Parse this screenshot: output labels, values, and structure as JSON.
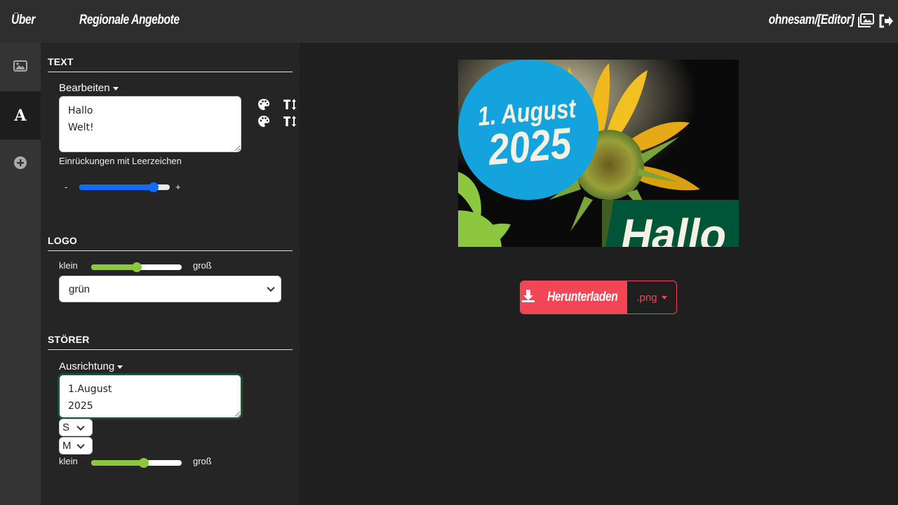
{
  "topbar": {
    "about_label": "Über",
    "regional_label": "Regionale Angebote",
    "user_label": "ohnesam/[Editor]"
  },
  "rail": {
    "items": [
      "image-icon",
      "text-icon",
      "add-icon"
    ],
    "active": "text-icon"
  },
  "text_section": {
    "title": "TEXT",
    "dropdown_label": "Bearbeiten",
    "textarea_value": "Hallo\nWelt!",
    "hint": "Einrückungen mit Leerzeichen",
    "minus": "-",
    "plus": "+",
    "slider_value": 0.82
  },
  "logo_section": {
    "title": "LOGO",
    "min_label": "klein",
    "max_label": "groß",
    "slider_value": 0.5,
    "select_value": "grün"
  },
  "stoerer_section": {
    "title": "STÖRER",
    "dropdown_label": "Ausrichtung",
    "textarea_value": "1.August\n2025",
    "select1_value": "S",
    "select2_value": "M",
    "min_label": "klein",
    "max_label": "groß",
    "slider_value": 0.58
  },
  "preview": {
    "badge_line1": "1. August",
    "badge_line2": "2025",
    "headline": "Hallo"
  },
  "download": {
    "button_label": "Herunterladen",
    "format_label": ".png"
  },
  "colors": {
    "accent": "#f24556",
    "badge_blue": "#14a3dc",
    "dark_green": "#005538",
    "light_green": "#8dc63f",
    "slider_blue": "#0d6efd"
  }
}
